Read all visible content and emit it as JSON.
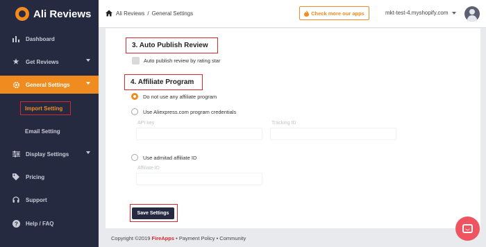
{
  "app": {
    "name": "Ali Reviews"
  },
  "sidebar": {
    "items": [
      {
        "label": "Dashboard",
        "icon": "bar-chart-icon"
      },
      {
        "label": "Get Reviews",
        "icon": "star-icon"
      },
      {
        "label": "General Settings",
        "icon": "gear-icon",
        "active": true
      },
      {
        "label": "Display Settings",
        "icon": "sliders-icon"
      },
      {
        "label": "Pricing",
        "icon": "tag-icon"
      },
      {
        "label": "Support",
        "icon": "headset-icon"
      },
      {
        "label": "Help / FAQ",
        "icon": "question-icon"
      }
    ],
    "sub_items": [
      {
        "label": "Import Setting"
      },
      {
        "label": "Email Setting"
      }
    ]
  },
  "header": {
    "breadcrumb": [
      "Ali Reviews",
      "/",
      "General Settings"
    ],
    "apps_button": "Check more our apps",
    "shop": "mkt-test-4.myshopify.com"
  },
  "main": {
    "auto_publish": {
      "title": "3. Auto Publish Review",
      "checkbox_label": "Auto publish review by rating star"
    },
    "affiliate": {
      "title": "4. Affiliate Program",
      "options": [
        {
          "label": "Do not use any affiliate program",
          "selected": true
        },
        {
          "label": "Use Aliexpress.com program credentials",
          "selected": false
        },
        {
          "label": "Use admitad affiliate ID",
          "selected": false
        }
      ],
      "api_key_label": "API key",
      "tracking_id_label": "Tracking ID",
      "affiliate_id_label": "Affiliate ID"
    },
    "save_button": "Save Settings"
  },
  "footer": {
    "copyright": "Copyright ©2019",
    "brand": "FireApps",
    "links": "• Payment Policy • Community"
  },
  "colors": {
    "accent": "#f08c1f",
    "sidebar": "#262a41",
    "highlight": "#d9262c"
  }
}
